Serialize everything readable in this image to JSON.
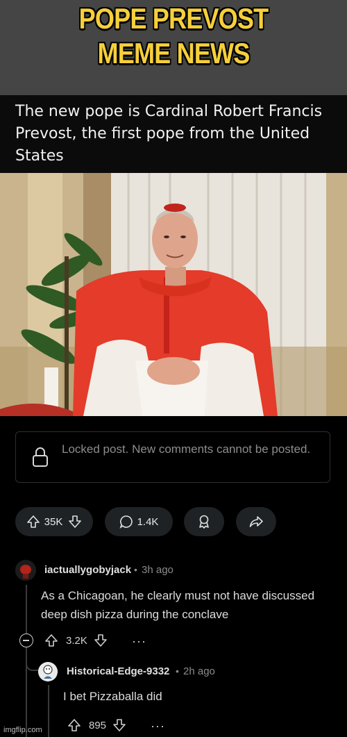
{
  "banner": {
    "line1": "POPE PREVOST",
    "line2": "MEME NEWS"
  },
  "post": {
    "title": "The new pope is Cardinal Robert Francis Prevost, the first pope from the United States",
    "locked_text": "Locked post. New comments cannot be posted.",
    "upvotes": "35K",
    "comments": "1.4K"
  },
  "comments": [
    {
      "username": "iactuallygobyjack",
      "separator": "•",
      "time": "3h ago",
      "text": "As a Chicagoan, he clearly must not have discussed deep dish pizza during the conclave",
      "score": "3.2K",
      "more": "···"
    },
    {
      "username": "Historical-Edge-9332",
      "separator": "•",
      "time": "2h ago",
      "text": "I bet Pizzaballa did",
      "score": "895",
      "more": "···"
    }
  ],
  "watermark": "imgflip.com",
  "colors": {
    "banner_bg": "#454545",
    "banner_text": "#f6cf3a",
    "page_bg": "#000000",
    "pill_bg": "#1f2224"
  },
  "icons": [
    "lock-icon",
    "upvote-icon",
    "downvote-icon",
    "comment-icon",
    "award-icon",
    "share-icon",
    "collapse-icon"
  ]
}
